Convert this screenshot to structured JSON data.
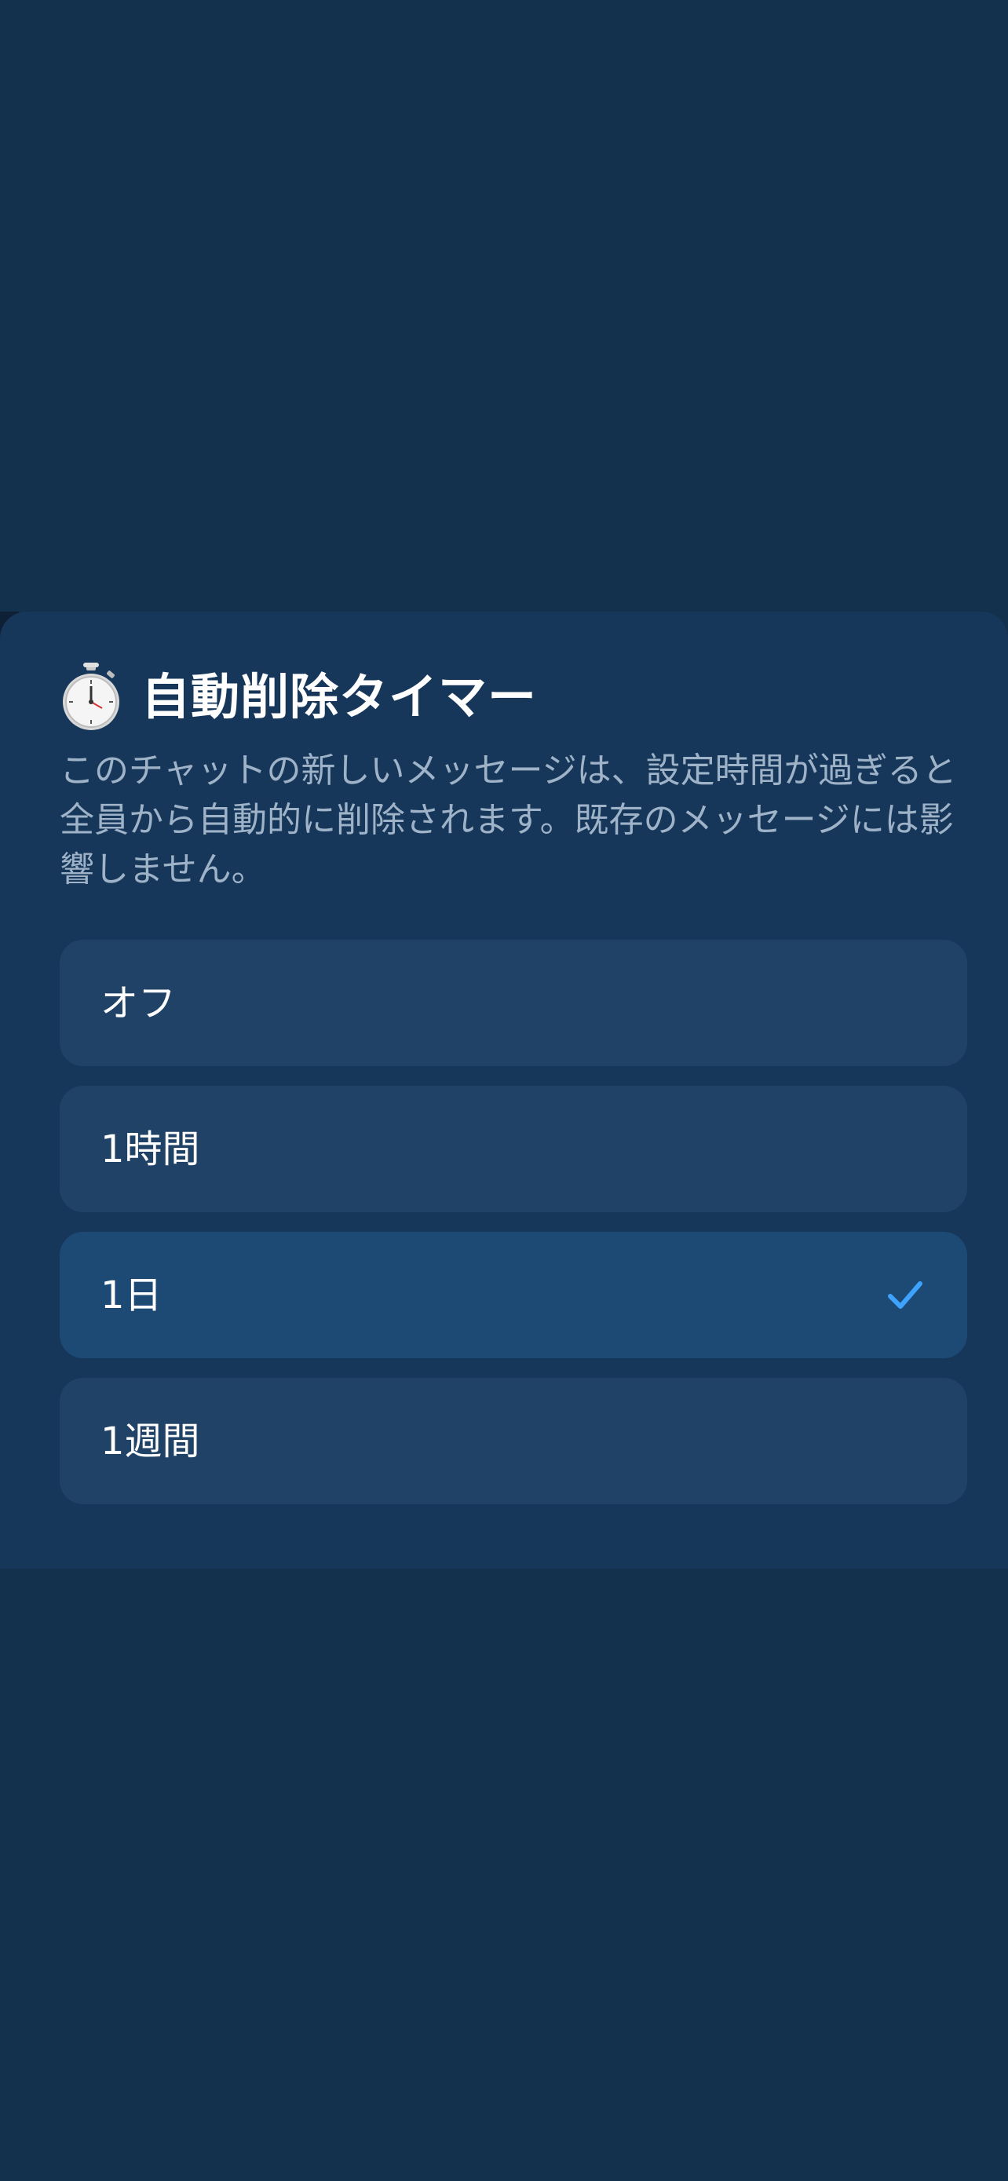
{
  "sheet": {
    "title": "自動削除タイマー",
    "title_icon": "stopwatch-icon",
    "description": "このチャットの新しいメッセージは、設定時間が過ぎると全員から自動的に削除されます。既存のメッセージには影響しません。"
  },
  "options": [
    {
      "label": "オフ",
      "selected": false
    },
    {
      "label": "1時間",
      "selected": false
    },
    {
      "label": "1日",
      "selected": true
    },
    {
      "label": "1週間",
      "selected": false
    }
  ],
  "colors": {
    "background": "#13304d",
    "sheet": "#17375a",
    "option": "#1f4266",
    "option_selected": "#1c4a75",
    "check": "#3ea2ff",
    "description": "#9fb3c8"
  }
}
